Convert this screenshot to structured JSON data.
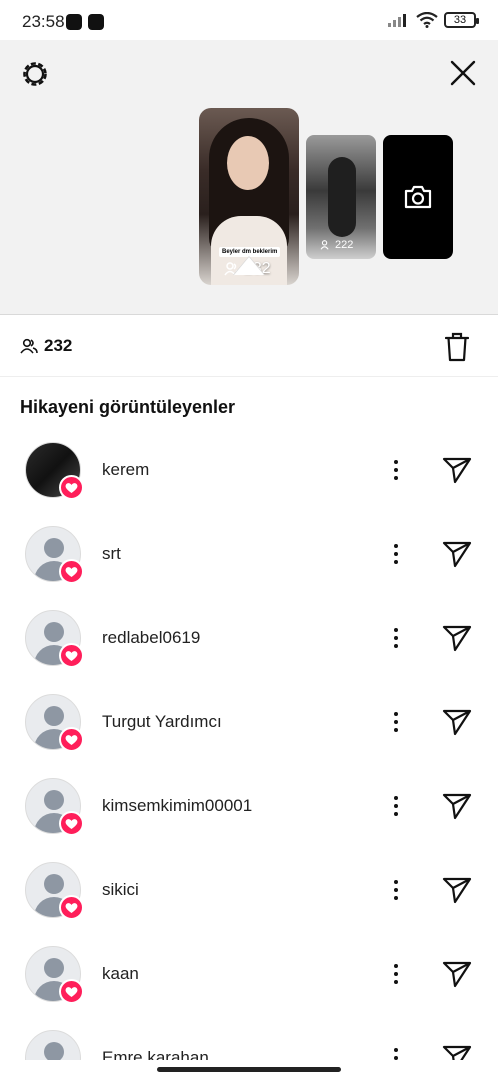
{
  "status": {
    "time": "23:58",
    "battery": "33"
  },
  "stories": {
    "main_caption": "Beyler dm beklerim",
    "main_count": "232",
    "second_count": "222"
  },
  "views": {
    "count": "232"
  },
  "section_title": "Hikayeni görüntüleyenler",
  "viewers": [
    {
      "name": "kerem"
    },
    {
      "name": "srt"
    },
    {
      "name": "redlabel0619"
    },
    {
      "name": "Turgut Yardımcı"
    },
    {
      "name": "kimsemkimim00001"
    },
    {
      "name": "sikici"
    },
    {
      "name": "kaan"
    },
    {
      "name": "Emre karahan"
    }
  ],
  "colors": {
    "heart": "#ff1e5a",
    "panel": "#f2f2f2"
  }
}
